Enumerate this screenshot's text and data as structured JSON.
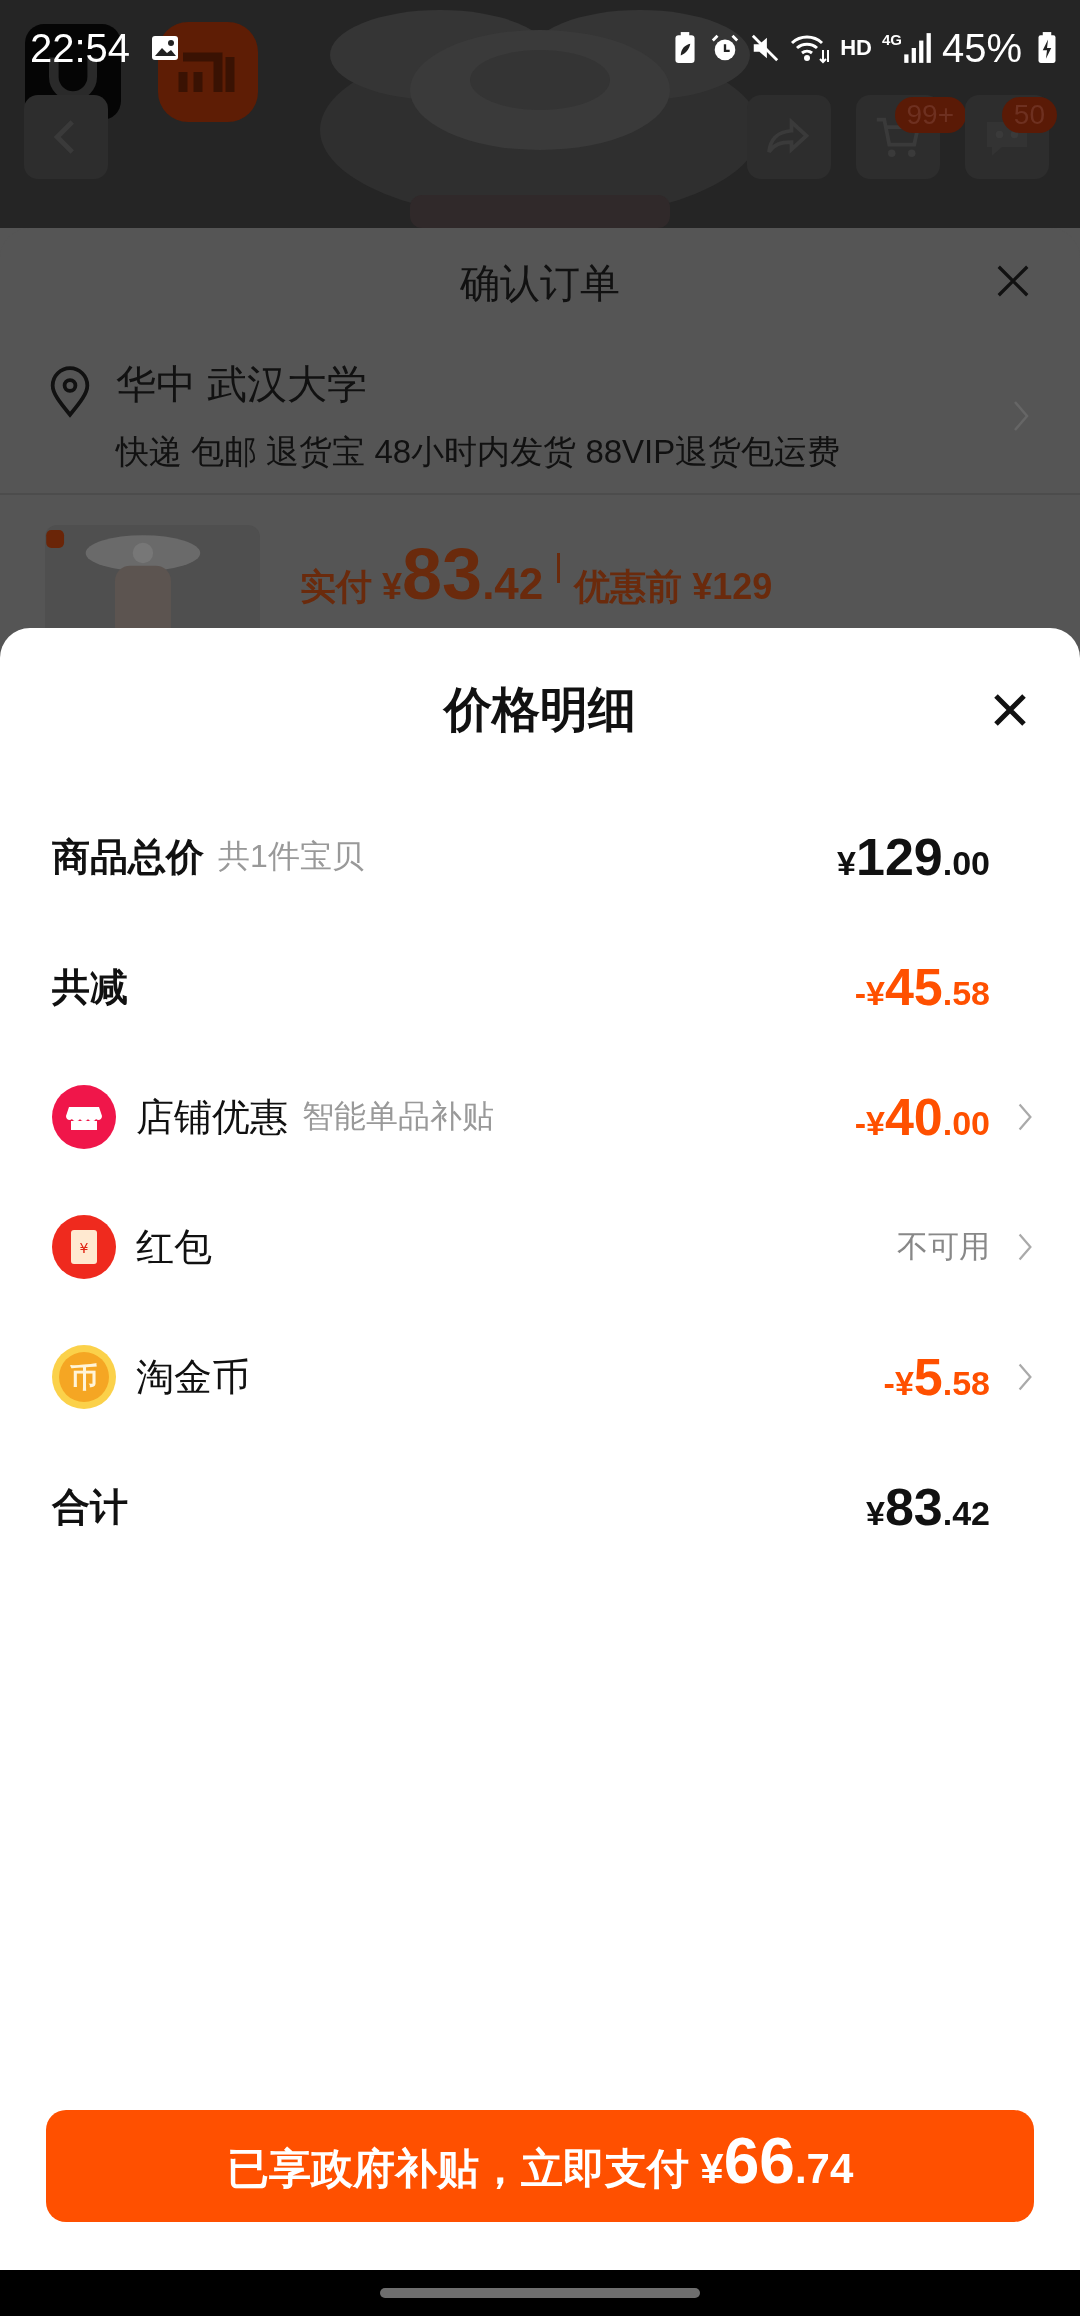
{
  "status_bar": {
    "time": "22:54",
    "network": "HD",
    "cellular": "4G",
    "battery": "45%"
  },
  "product_header": {
    "kind": "picture",
    "toolbar": [
      {
        "kind": "share"
      },
      {
        "kind": "cart",
        "badge": "99+"
      },
      {
        "kind": "chat",
        "badge": "50"
      }
    ]
  },
  "order_sheet": {
    "title": "确认订单",
    "address": {
      "place": "华中 武汉大学",
      "services": "快递 包邮 退货宝 48小时内发货 88VIP退货包运费"
    },
    "product": {
      "paid_label": "实付",
      "currency": "¥",
      "whole": "83",
      "fraction": ".42",
      "original": "优惠前 ¥129"
    }
  },
  "price_detail": {
    "title": "价格明细",
    "rows": [
      {
        "kind": "subtotal",
        "label": "商品总价",
        "note": "共1件宝贝",
        "amount": {
          "currency": "¥",
          "whole": "129",
          "fraction": ".00"
        }
      },
      {
        "kind": "reduction",
        "label": "共减",
        "amount": {
          "currency": "-¥",
          "whole": "45",
          "fraction": ".58"
        }
      },
      {
        "kind": "store",
        "label": "店铺优惠",
        "note": "智能单品补贴",
        "amount": {
          "currency": "-¥",
          "whole": "40",
          "fraction": ".00"
        }
      },
      {
        "kind": "red_packet",
        "label": "红包",
        "icon_glyph": "¥",
        "status": "不可用"
      },
      {
        "kind": "coin",
        "label": "淘金币",
        "icon_glyph": "币",
        "amount": {
          "currency": "-¥",
          "whole": "5",
          "fraction": ".58"
        }
      },
      {
        "kind": "total",
        "label": "合计",
        "amount": {
          "currency": "¥",
          "whole": "83",
          "fraction": ".42"
        }
      }
    ],
    "pay_button": {
      "text": "已享政府补贴，立即支付",
      "currency": "¥",
      "whole": "66",
      "fraction": ".74"
    }
  }
}
